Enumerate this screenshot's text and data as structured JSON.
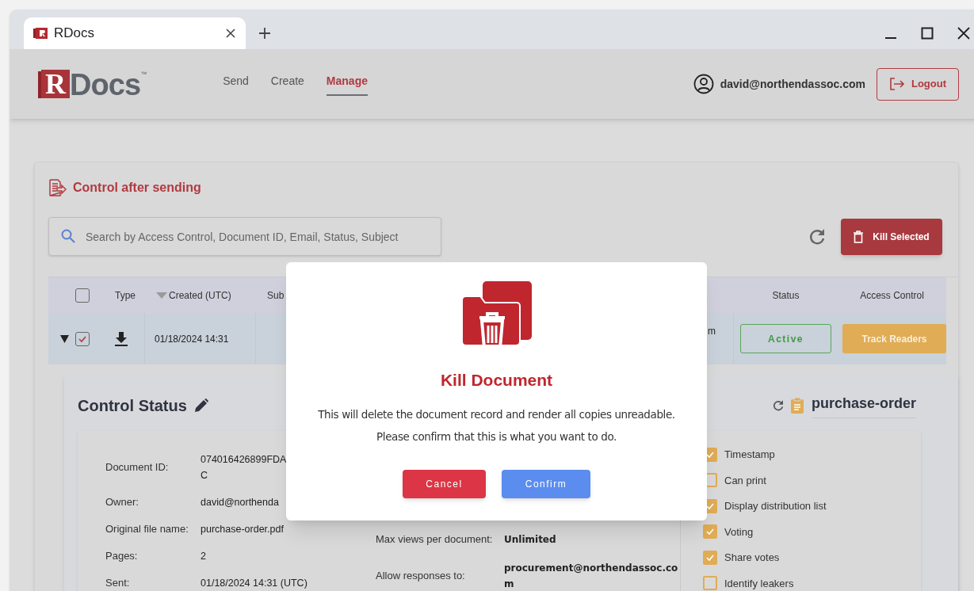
{
  "browser": {
    "tab_title": "RDocs"
  },
  "header": {
    "logo_mark": "R",
    "logo_text": "Docs",
    "trademark": "™",
    "nav": [
      {
        "label": "Send",
        "selected": false
      },
      {
        "label": "Create",
        "selected": false
      },
      {
        "label": "Manage",
        "selected": true
      }
    ],
    "user_email": "david@northendassoc.com",
    "logout": "Logout"
  },
  "section": {
    "title": "Control after sending",
    "search": {
      "placeholder": "Search by Access Control, Document ID, Email, Status, Subject"
    },
    "kill_button": "Kill Selected"
  },
  "table": {
    "header_checked": false,
    "columns": [
      {
        "label": "Type",
        "sorted": false
      },
      {
        "label": "Created (UTC)",
        "sorted": true
      },
      {
        "label": "Sub",
        "sorted": false
      },
      {
        "label": "Status",
        "sorted": false
      },
      {
        "label": "Access Control",
        "sorted": false
      }
    ],
    "rows": [
      {
        "expanded": true,
        "checked": true,
        "created": "01/18/2024 14:31",
        "column_4": "m",
        "status": "Active",
        "action": "Track Readers"
      }
    ]
  },
  "detail": {
    "title": "Control Status",
    "document": "purchase-order",
    "fields": [
      {
        "label": "Document ID:",
        "value": "074016426899FDA\nC"
      },
      {
        "label": "Owner:",
        "value": "david@northenda"
      },
      {
        "label": "Original file name:",
        "value": "purchase-order.pdf"
      },
      {
        "label": "Pages:",
        "value": "2"
      },
      {
        "label": "Sent:",
        "value": "01/18/2024 14:31 (UTC)"
      }
    ],
    "settings": [
      {
        "label": "Max views per document:",
        "value": "Unlimited"
      },
      {
        "label": "Allow responses to:",
        "value": "procurement@northendassoc.co\nm"
      }
    ],
    "options": [
      {
        "label": "Timestamp",
        "checked": true
      },
      {
        "label": "Can print",
        "checked": false
      },
      {
        "label": "Display distribution list",
        "checked": true
      },
      {
        "label": "Voting",
        "checked": true
      },
      {
        "label": "Share votes",
        "checked": true
      },
      {
        "label": "Identify leakers",
        "checked": false
      }
    ]
  },
  "modal": {
    "title": "Kill Document",
    "message": [
      "This will delete the document record and render all copies unreadable.",
      "Please confirm that this is what you want to do."
    ],
    "buttons": [
      {
        "label": "Cancel",
        "kind": "cancel"
      },
      {
        "label": "Confirm",
        "kind": "confirm"
      }
    ]
  }
}
